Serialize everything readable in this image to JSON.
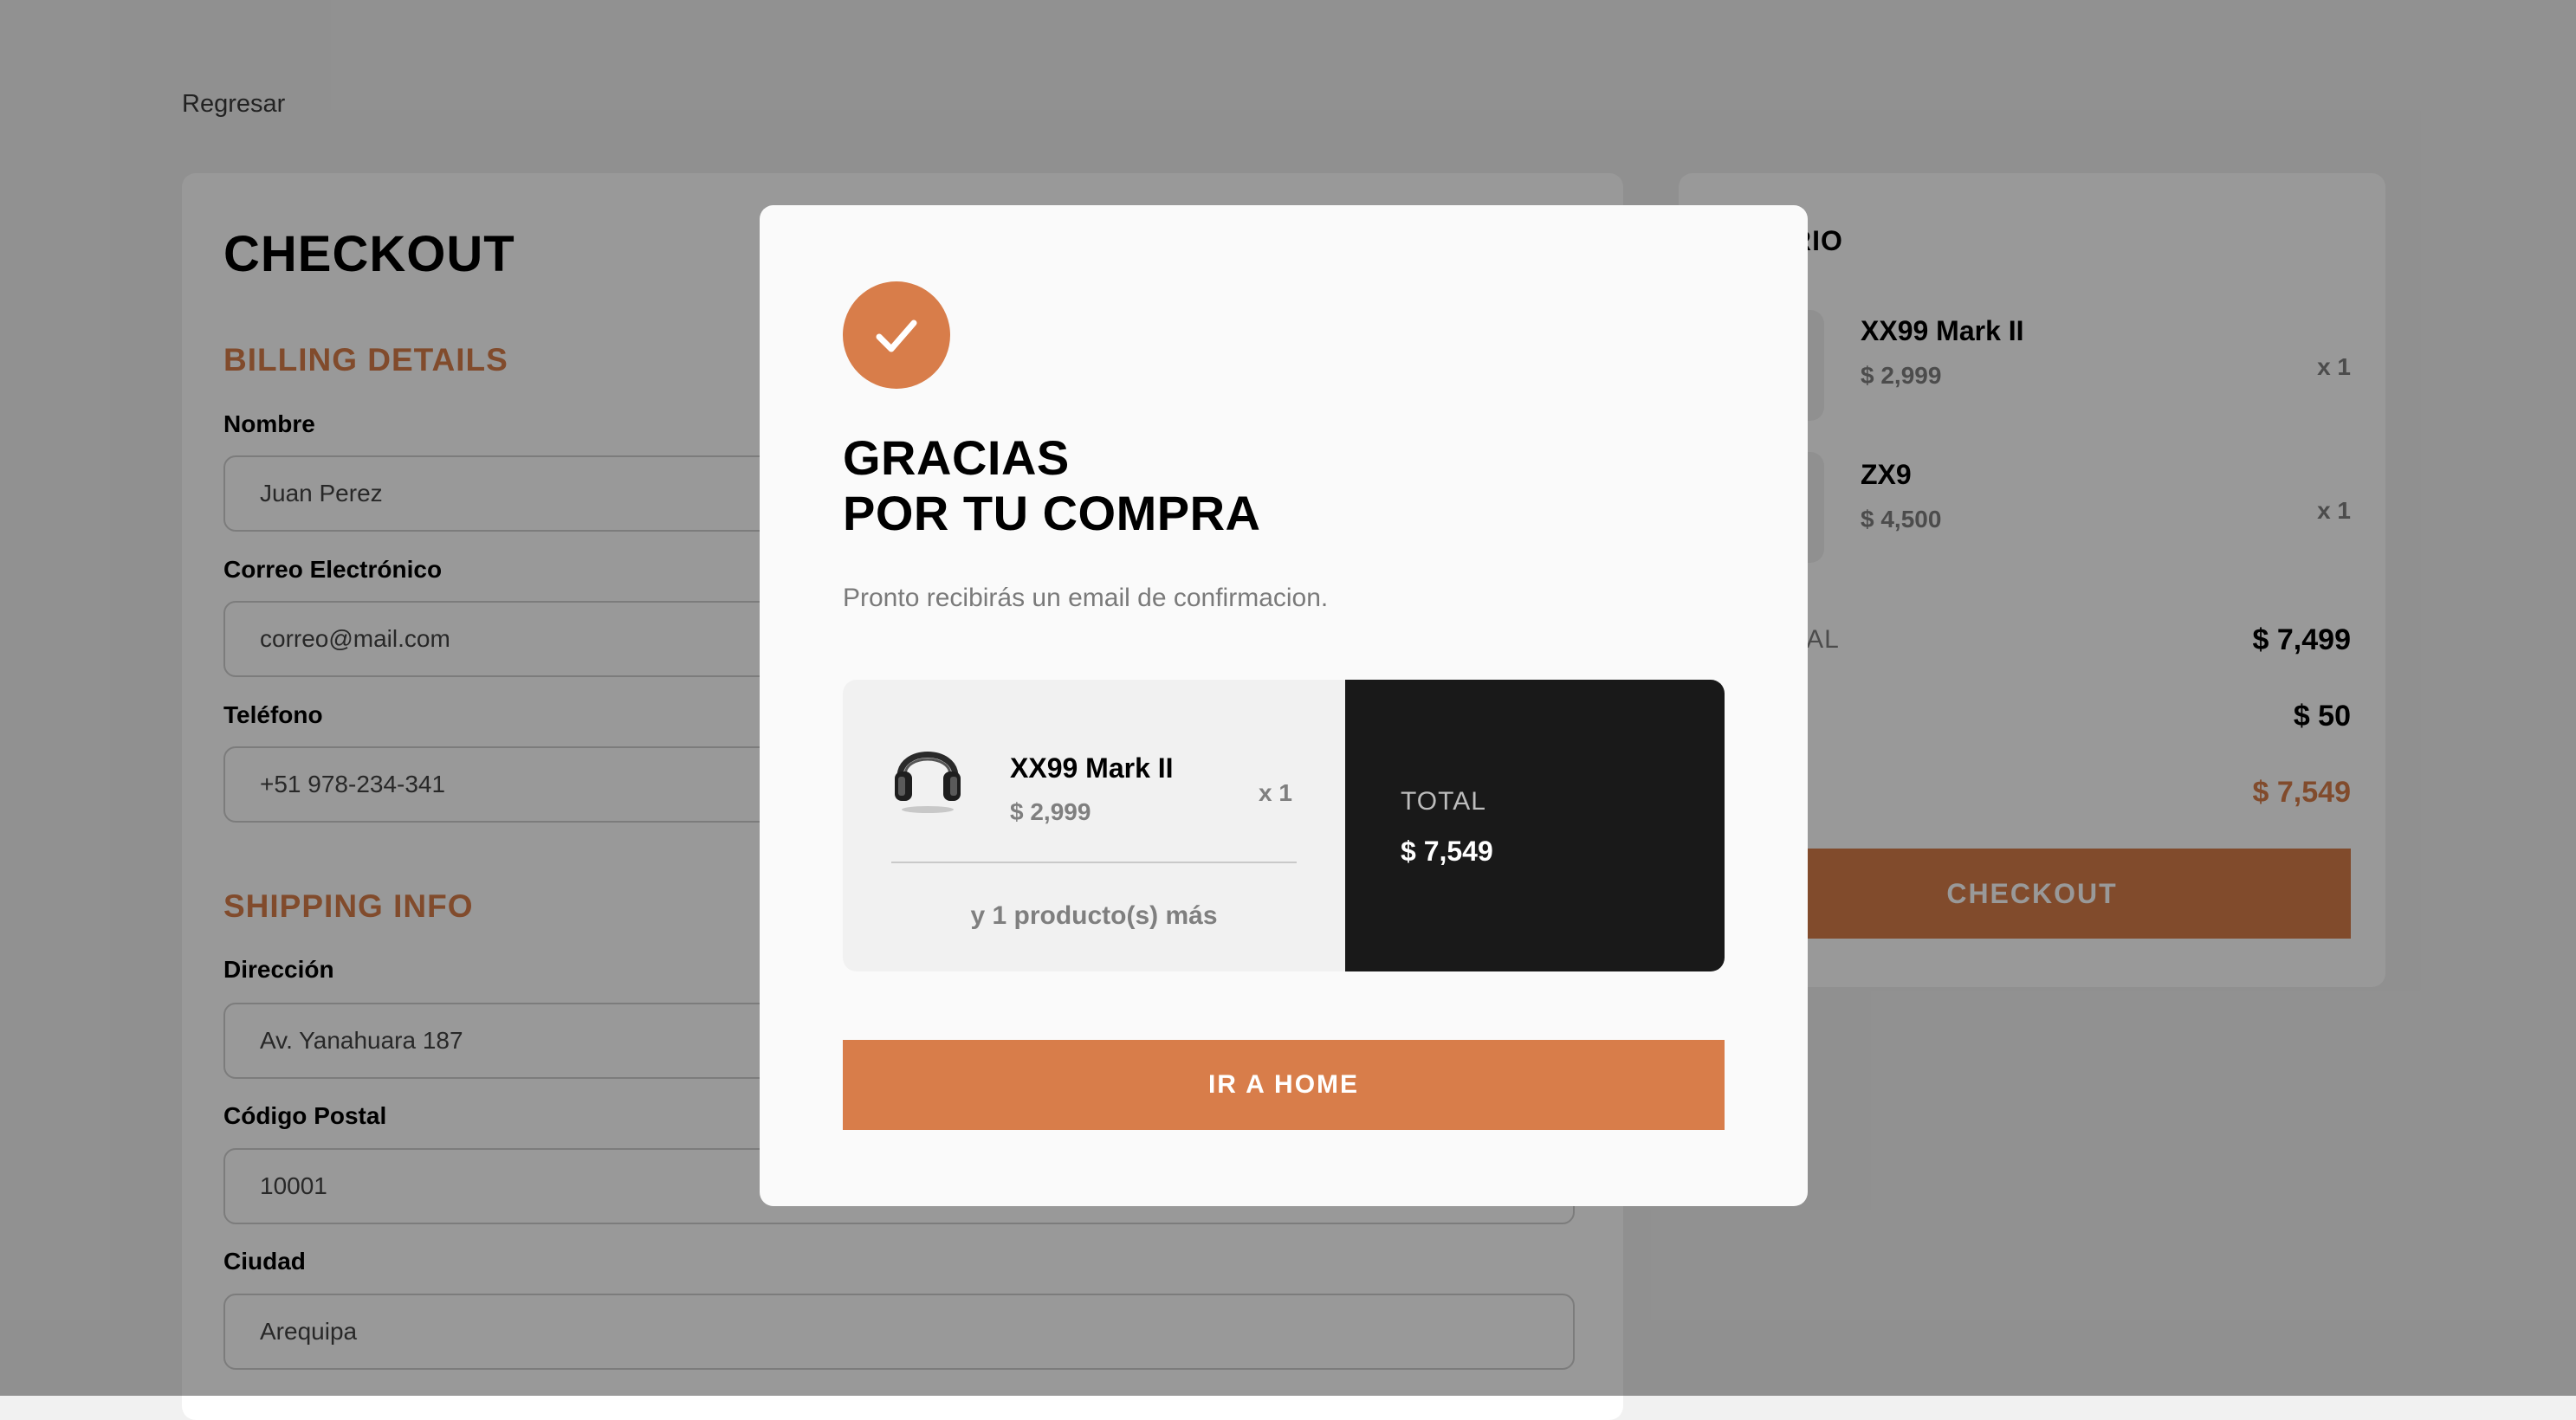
{
  "nav": {
    "back_label": "Regresar"
  },
  "checkout": {
    "title": "CHECKOUT",
    "billing": {
      "title": "BILLING DETAILS",
      "name": {
        "label": "Nombre",
        "value": "Juan Perez"
      },
      "email": {
        "label": "Correo Electrónico",
        "value": "correo@mail.com"
      },
      "phone": {
        "label": "Teléfono",
        "value": "+51 978-234-341"
      }
    },
    "shipping": {
      "title": "SHIPPING INFO",
      "address": {
        "label": "Dirección",
        "value": "Av. Yanahuara 187"
      },
      "zip": {
        "label": "Código Postal",
        "value": "10001"
      },
      "city": {
        "label": "Ciudad",
        "value": "Arequipa"
      }
    }
  },
  "summary": {
    "title": "RIO",
    "items": [
      {
        "name": "XX99 Mark II",
        "price": "$ 2,999",
        "qty": "x 1"
      },
      {
        "name": "ZX9",
        "price": "$ 4,500",
        "qty": "x 1"
      }
    ],
    "rows": [
      {
        "label": "TAL",
        "value": "$ 7,499"
      },
      {
        "label": "",
        "value": "$ 50"
      },
      {
        "label": "",
        "value": "$ 7,549"
      }
    ],
    "checkout_label": "CHECKOUT"
  },
  "modal": {
    "title_line1": "GRACIAS",
    "title_line2": "POR TU COMPRA",
    "subtitle": "Pronto recibirás un email de confirmacion.",
    "order": {
      "item": {
        "name": "XX99 Mark II",
        "price": "$ 2,999",
        "qty": "x 1",
        "icon": "headphones-icon"
      },
      "more": "y 1 producto(s) más",
      "total_label": "TOTAL",
      "total_value": "$ 7,549"
    },
    "home_button": "IR A HOME"
  },
  "colors": {
    "accent": "#d87d4a",
    "dark": "#191919",
    "overlay": "rgba(0,0,0,0.4)"
  }
}
